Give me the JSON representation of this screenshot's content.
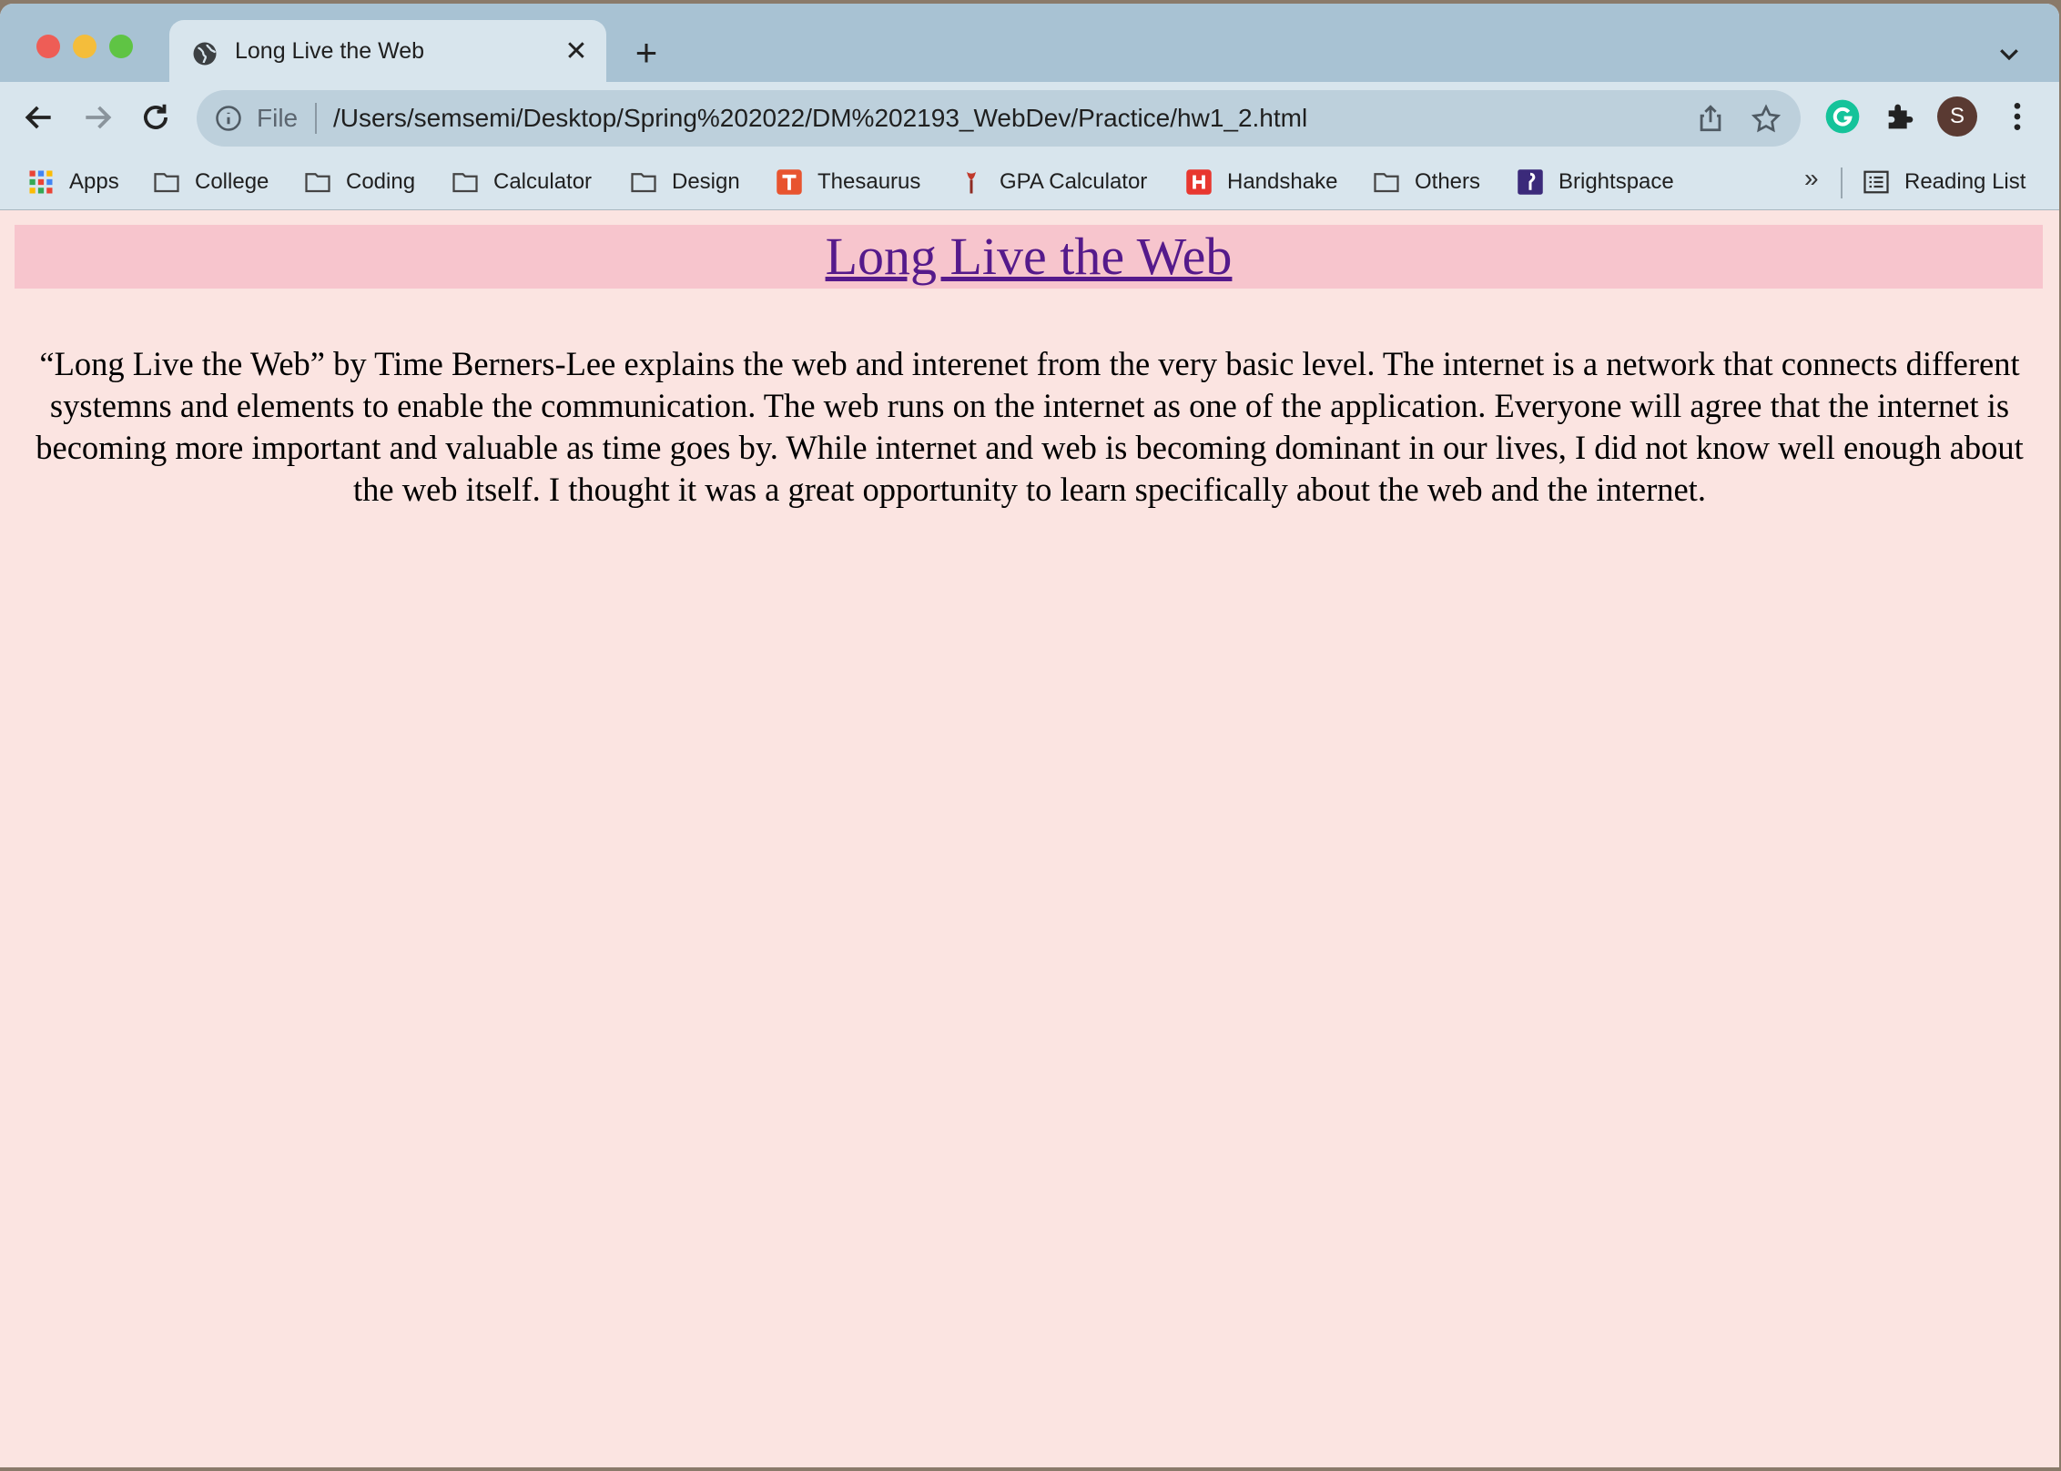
{
  "window": {
    "controls": [
      "close",
      "minimize",
      "maximize"
    ]
  },
  "tab": {
    "title": "Long Live the Web",
    "favicon": "globe-icon"
  },
  "toolbar": {
    "scheme_label": "File",
    "url": "/Users/semsemi/Desktop/Spring%202022/DM%202193_WebDev/Practice/hw1_2.html",
    "profile_initial": "S"
  },
  "bookmarks": {
    "items": [
      {
        "label": "Apps",
        "icon": "apps-grid-icon"
      },
      {
        "label": "College",
        "icon": "folder-icon"
      },
      {
        "label": "Coding",
        "icon": "folder-icon"
      },
      {
        "label": "Calculator",
        "icon": "folder-icon"
      },
      {
        "label": "Design",
        "icon": "folder-icon"
      },
      {
        "label": "Thesaurus",
        "icon": "thesaurus-icon"
      },
      {
        "label": "GPA Calculator",
        "icon": "torch-icon"
      },
      {
        "label": "Handshake",
        "icon": "handshake-icon"
      },
      {
        "label": "Others",
        "icon": "folder-icon"
      },
      {
        "label": "Brightspace",
        "icon": "brightspace-icon"
      }
    ],
    "more": "»",
    "reading_list": "Reading List"
  },
  "page": {
    "title": "Long Live the Web",
    "body": "“Long Live the Web” by Time Berners-Lee explains the web and interenet from the very basic level. The internet is a network that connects different systemns and elements to enable the communication. The web runs on the internet as one of the application. Everyone will agree that the internet is becoming more important and valuable as time goes by. While internet and web is becoming dominant in our lives, I did not know well enough about the web itself. I thought it was a great opportunity to learn specifically about the web and the internet."
  },
  "colors": {
    "page_background": "#fbe4e1",
    "header_background": "#f7c5cd",
    "link_color": "#551a8b",
    "tabstrip": "#a8c2d3",
    "toolbar": "#d8e5ed"
  }
}
